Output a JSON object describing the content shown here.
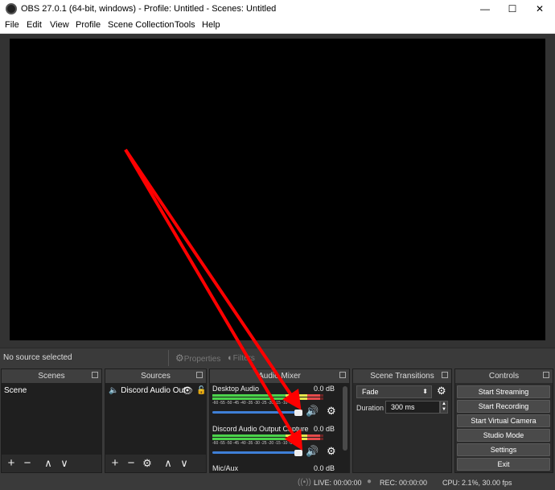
{
  "window": {
    "title": "OBS 27.0.1 (64-bit, windows) - Profile: Untitled - Scenes: Untitled",
    "min_glyph": "—",
    "max_glyph": "☐",
    "close_glyph": "✕"
  },
  "menu": [
    "File",
    "Edit",
    "View",
    "Profile",
    "Scene Collection",
    "Tools",
    "Help"
  ],
  "context_bar": {
    "status": "No source selected",
    "properties": "Properties",
    "filters": "Filters"
  },
  "docks": {
    "scenes": {
      "title": "Scenes",
      "items": [
        "Scene"
      ]
    },
    "sources": {
      "title": "Sources",
      "items": [
        "Discord Audio Out"
      ]
    },
    "mixer": {
      "title": "Audio Mixer",
      "channels": [
        {
          "name": "Desktop Audio",
          "db": "0.0 dB",
          "level": 0.97,
          "volume": 1.0
        },
        {
          "name": "Discord Audio Output Capture",
          "db": "0.0 dB",
          "level": 0.97,
          "volume": 1.0
        },
        {
          "name": "Mic/Aux",
          "db": "0.0 dB"
        }
      ],
      "ticks": "-60 -55 -50 -45 -40 -35 -30 -25 -20 -15 -10 -5 0"
    },
    "transitions": {
      "title": "Scene Transitions",
      "selected": "Fade",
      "duration_label": "Duration",
      "duration_value": "300 ms"
    },
    "controls": {
      "title": "Controls",
      "buttons": [
        "Start Streaming",
        "Start Recording",
        "Start Virtual Camera",
        "Studio Mode",
        "Settings",
        "Exit"
      ]
    }
  },
  "status": {
    "live": "LIVE: 00:00:00",
    "rec": "REC: 00:00:00",
    "cpu": "CPU: 2.1%, 30.00 fps"
  },
  "colors": {
    "annotation_arrow": "#ff0000",
    "meter_green": "#4bd34b",
    "slider_blue": "#3f7fd6"
  }
}
